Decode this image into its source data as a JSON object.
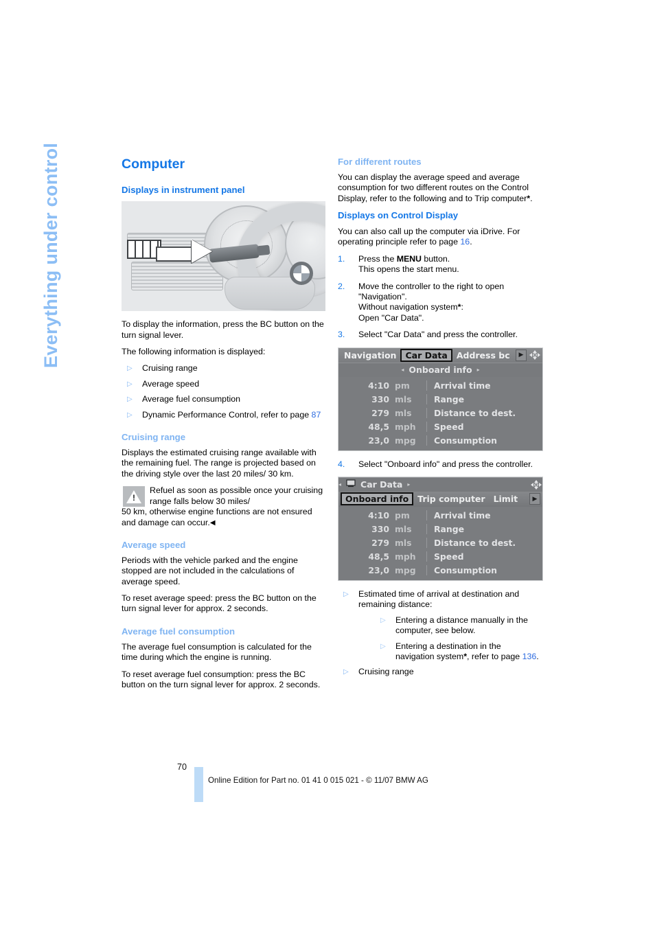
{
  "chapter_tab": "Everything under control",
  "page_number": "70",
  "footer_text": "Online Edition for Part no. 01 41 0 015 021 - © 11/07 BMW AG",
  "left_column": {
    "section_title": "Computer",
    "heading_displays_instrument_panel": "Displays in instrument panel",
    "figure_dashboard": {
      "name": "instrument-panel-bc-button-photo",
      "watermark": ""
    },
    "intro_1": "To display the information, press the BC button on the turn signal lever.",
    "intro_2": "The following information is displayed:",
    "info_items": [
      "Cruising range",
      "Average speed",
      "Average fuel consumption",
      "Dynamic Performance Control, refer to page 87"
    ],
    "info_item_4_prefix": "Dynamic Performance Control, refer to page ",
    "info_item_4_pageref": "87",
    "heading_cruising_range": "Cruising range",
    "cruising_range_body": "Displays the estimated cruising range available with the remaining fuel. The range is projected based on the driving style over the last 20 miles/ 30 km.",
    "warning_text_1": "Refuel as soon as possible once your cruising range falls below 30 miles/",
    "warning_text_2": "50 km, otherwise engine functions are not ensured and damage can occur.",
    "warning_endmark": "◀",
    "heading_average_speed": "Average speed",
    "average_speed_body_1": "Periods with the vehicle parked and the engine stopped are not included in the calculations of average speed.",
    "average_speed_body_2": "To reset average speed: press the BC button on the turn signal lever for approx. 2 seconds.",
    "heading_average_fuel": "Average fuel consumption",
    "average_fuel_body_1": "The average fuel consumption is calculated for the time during which the engine is running.",
    "average_fuel_body_2": "To reset average fuel consumption: press the BC button on the turn signal lever for approx. 2 seconds."
  },
  "right_column": {
    "heading_for_different_routes": "For different routes",
    "for_different_routes_body_prefix": "You can display the average speed and average consumption for two different routes on the Control Display, refer to the following and to Trip computer",
    "for_different_routes_body_suffix": ".",
    "asterisk": "*",
    "heading_displays_control_display": "Displays on Control Display",
    "control_display_body_prefix": "You can also call up the computer via iDrive. For operating principle refer to page ",
    "control_display_pageref": "16",
    "control_display_body_suffix": ".",
    "steps": [
      {
        "num": "1.",
        "pre": "Press the ",
        "kbd": "MENU",
        "post": " button.",
        "line2": "This opens the start menu."
      },
      {
        "num": "2.",
        "line1": "Move the controller to the right to open \"Navigation\".",
        "line2_pre": "Without navigation system",
        "line2_post": ":",
        "line3": "Open \"Car Data\"."
      },
      {
        "num": "3.",
        "line1": "Select \"Car Data\" and press the controller."
      },
      {
        "num": "4.",
        "line1": "Select \"Onboard info\" and press the controller."
      }
    ],
    "screen_1": {
      "name": "car-data-onboard-info-screen",
      "menu_items": [
        "Navigation",
        "Car Data",
        "Address bc"
      ],
      "selected_menu_item": "Car Data",
      "title": "Onboard info",
      "left_arrow": "◂",
      "right_arrow": "▸",
      "rows": [
        {
          "value": "4:10",
          "unit": "pm",
          "label": "Arrival time"
        },
        {
          "value": "330",
          "unit": "mls",
          "label": "Range"
        },
        {
          "value": "279",
          "unit": "mls",
          "label": "Distance to dest."
        },
        {
          "value": "48,5",
          "unit": "mph",
          "label": "Speed"
        },
        {
          "value": "23,0",
          "unit": "mpg",
          "label": "Consumption"
        }
      ]
    },
    "screen_2": {
      "name": "onboard-info-trip-computer-screen",
      "title": "Car Data",
      "left_arrow": "◂",
      "right_arrow": "▸",
      "tabs": [
        "Onboard info",
        "Trip computer",
        "Limit"
      ],
      "selected_tab": "Onboard info",
      "rows": [
        {
          "value": "4:10",
          "unit": "pm",
          "label": "Arrival time"
        },
        {
          "value": "330",
          "unit": "mls",
          "label": "Range"
        },
        {
          "value": "279",
          "unit": "mls",
          "label": "Distance to dest."
        },
        {
          "value": "48,5",
          "unit": "mph",
          "label": "Speed"
        },
        {
          "value": "23,0",
          "unit": "mpg",
          "label": "Consumption"
        }
      ]
    },
    "outcome_items": {
      "item_1": "Estimated time of arrival at destination and remaining distance:",
      "sub_1": "Entering a distance manually in the computer, see below.",
      "sub_2_pre": "Entering a destination in the navigation system",
      "sub_2_mid": ", refer to page ",
      "sub_2_pageref": "136",
      "sub_2_post": ".",
      "item_2": "Cruising range"
    }
  },
  "colors": {
    "heading_blue": "#1477E6",
    "subheading_light_blue": "#7FB4F2",
    "chapter_tab_blue": "#8CBEF5",
    "page_ref_blue": "#2E6CE0",
    "footer_bar_blue": "#BDDBF7"
  }
}
